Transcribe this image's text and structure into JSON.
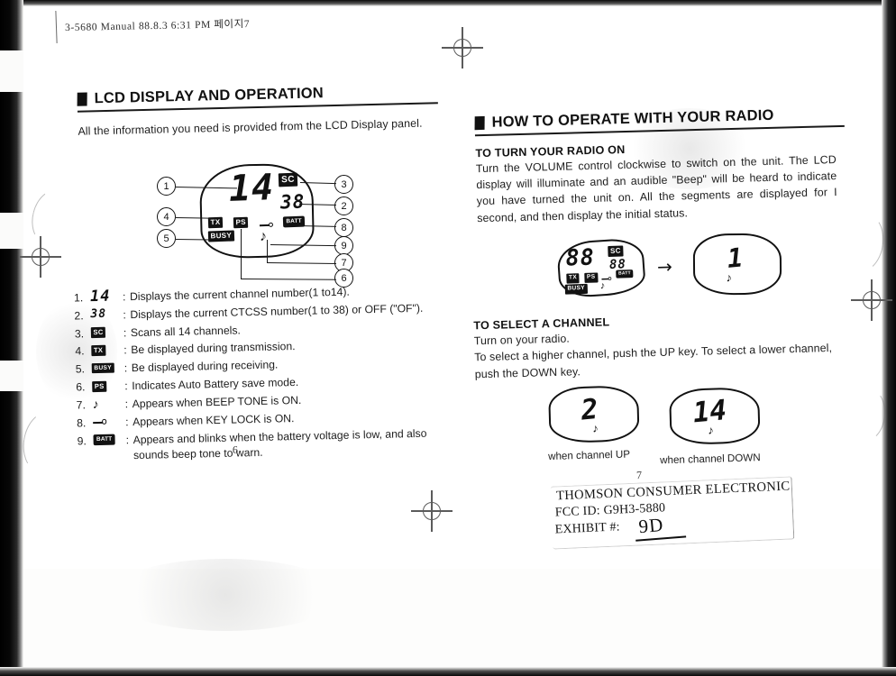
{
  "scan": {
    "slug": "3-5680 Manual   88.8.3 6:31 PM 페이지7"
  },
  "left_page": {
    "section_title": "LCD DISPLAY AND OPERATION",
    "intro": "All the information you need is provided from the LCD Display panel.",
    "page_number": "6",
    "lcd_figure": {
      "channel_digits": "14",
      "ctcss_digits": "38",
      "badge_sc": "SC",
      "badge_tx": "TX",
      "badge_ps": "PS",
      "badge_busy": "BUSY",
      "badge_batt": "BATT",
      "note_glyph": "♪",
      "callouts": [
        "1",
        "2",
        "3",
        "4",
        "5",
        "6",
        "7",
        "8",
        "9"
      ]
    },
    "items": [
      {
        "index": "1.",
        "symbol": "14",
        "symbol_kind": "seg",
        "desc": "Displays the current channel number(1 to14)."
      },
      {
        "index": "2.",
        "symbol": "38",
        "symbol_kind": "seg",
        "desc": "Displays the current CTCSS number(1 to 38) or OFF (\"OF\")."
      },
      {
        "index": "3.",
        "symbol": "SC",
        "symbol_kind": "badge",
        "desc": "Scans all 14 channels."
      },
      {
        "index": "4.",
        "symbol": "TX",
        "symbol_kind": "badge",
        "desc": "Be displayed during transmission."
      },
      {
        "index": "5.",
        "symbol": "BUSY",
        "symbol_kind": "badge",
        "desc": "Be displayed during receiving."
      },
      {
        "index": "6.",
        "symbol": "PS",
        "symbol_kind": "badge",
        "desc": "Indicates Auto Battery save mode."
      },
      {
        "index": "7.",
        "symbol": "♪",
        "symbol_kind": "note",
        "desc": "Appears when BEEP TONE is ON."
      },
      {
        "index": "8.",
        "symbol": "",
        "symbol_kind": "key",
        "desc": "Appears when KEY LOCK is ON."
      },
      {
        "index": "9.",
        "symbol": "BATT",
        "symbol_kind": "batt",
        "desc": "Appears and blinks when the battery voltage is low, and also sounds beep tone to warn."
      }
    ]
  },
  "right_page": {
    "section_title": "HOW TO OPERATE WITH YOUR RADIO",
    "page_number": "7",
    "turn_on": {
      "heading": "TO TURN YOUR RADIO ON",
      "body": "Turn the VOLUME control clockwise to switch on the unit. The LCD display will illuminate and an audible \"Beep\" will be heard to indicate you have turned the unit on. All the segments are displayed for I second, and then display the initial status."
    },
    "turn_on_figure": {
      "all_segments_digits": "88",
      "all_segments_ctcss": "88",
      "badge_sc": "SC",
      "badge_tx": "TX",
      "badge_ps": "PS",
      "badge_busy": "BUSY",
      "badge_batt": "BATT",
      "note_glyph": "♪",
      "arrow": "→",
      "initial_status_digits": "1"
    },
    "select_channel": {
      "heading": "TO SELECT A CHANNEL",
      "line1": "Turn on your radio.",
      "line2": "To select a higher channel, push the UP key. To select a lower channel, push the DOWN key."
    },
    "channel_figures": [
      {
        "digits": "2",
        "note_glyph": "♪",
        "caption": "when channel UP"
      },
      {
        "digits": "14",
        "note_glyph": "♪",
        "caption": "when channel DOWN"
      }
    ]
  },
  "fcc_stamp": {
    "company": "THOMSON CONSUMER ELECTRONIC",
    "fcc_id": "FCC ID:  G9H3-5880",
    "exhibit_label": "EXHIBIT #:",
    "exhibit_value": "9D"
  }
}
